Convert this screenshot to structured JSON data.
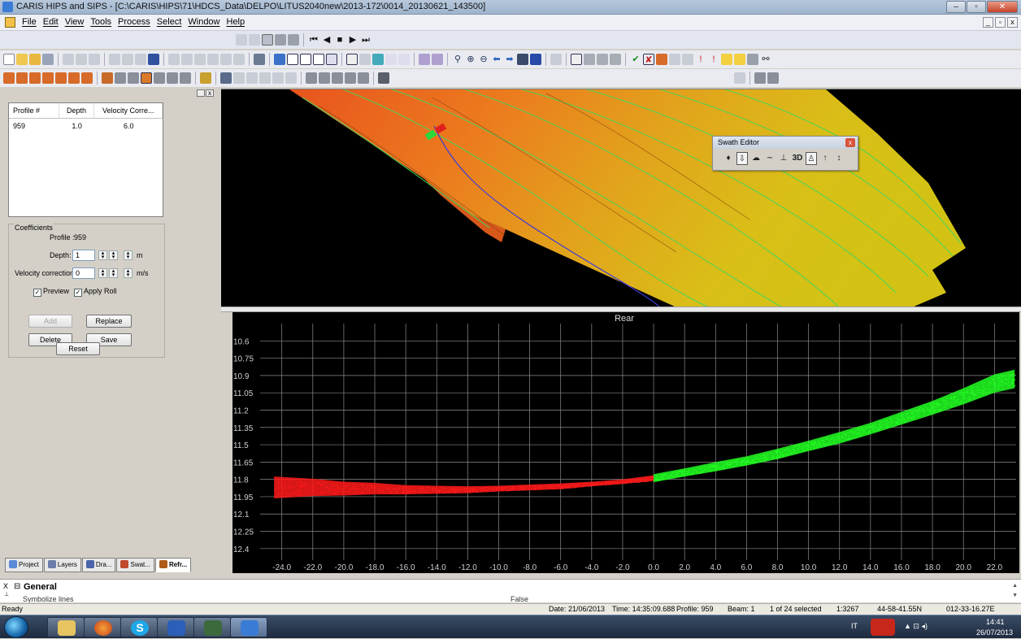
{
  "window": {
    "title": "CARIS HIPS and SIPS - [C:\\CARIS\\HIPS\\71\\HDCS_Data\\DELPO\\LITUS2040new\\2013-172\\0014_20130621_143500]",
    "minimize": "–",
    "maximize": "▫",
    "close": "✕"
  },
  "menu": {
    "items": [
      "File",
      "Edit",
      "View",
      "Tools",
      "Process",
      "Select",
      "Window",
      "Help"
    ],
    "mdi_min": "_",
    "mdi_restore": "▫",
    "mdi_close": "x"
  },
  "left_panel": {
    "table": {
      "headers": [
        "Profile #",
        "Depth",
        "Velocity Corre..."
      ],
      "rows": [
        [
          "959",
          "1.0",
          "6.0"
        ]
      ]
    },
    "coefficients": {
      "title": "Coefficients",
      "profile_label": "Profile :",
      "profile_value": "959",
      "depth_label": "Depth:",
      "depth_value": "1",
      "depth_unit": "m",
      "velocity_label": "Velocity correction:",
      "velocity_value": "0",
      "velocity_unit": "m/s",
      "preview_label": "Preview",
      "apply_roll_label": "Apply Roll"
    },
    "buttons": {
      "add": "Add",
      "replace": "Replace",
      "delete": "Delete",
      "save": "Save",
      "reset": "Reset"
    },
    "tabs": [
      "Project",
      "Layers",
      "Dra...",
      "Swat...",
      "Refr..."
    ],
    "tab_colors": [
      "#5b8bd6",
      "#6a7da8",
      "#4b63a8",
      "#c0482c",
      "#b05a18"
    ]
  },
  "swath_editor": {
    "title": "Swath Editor",
    "tools": [
      "♦",
      "⇩",
      "☁",
      "∼",
      "⊥",
      "3D",
      "♙",
      "↑",
      "↕"
    ],
    "close": "x"
  },
  "chart_data": {
    "type": "scatter",
    "title": "Rear",
    "xlabel": "",
    "ylabel": "",
    "x_ticks": [
      "-24.0",
      "-22.0",
      "-20.0",
      "-18.0",
      "-16.0",
      "-14.0",
      "-12.0",
      "-10.0",
      "-8.0",
      "-6.0",
      "-4.0",
      "-2.0",
      "0.0",
      "2.0",
      "4.0",
      "6.0",
      "8.0",
      "10.0",
      "12.0",
      "14.0",
      "16.0",
      "18.0",
      "20.0",
      "22.0"
    ],
    "y_ticks": [
      "10.6",
      "10.75",
      "10.9",
      "11.05",
      "11.2",
      "11.35",
      "11.5",
      "11.65",
      "11.8",
      "11.95",
      "12.1",
      "12.25",
      "12.4"
    ],
    "xlim": [
      -25.4,
      23.4
    ],
    "ylim": [
      10.45,
      12.5
    ],
    "y_inverted": true,
    "grid": true,
    "series": [
      {
        "color": "#ff1a1a",
        "x": [
          -24.5,
          -22,
          -20,
          -18,
          -16,
          -14,
          -12,
          -10,
          -8,
          -6,
          -4,
          -2,
          0
        ],
        "y": [
          11.87,
          11.87,
          11.88,
          11.88,
          11.89,
          11.89,
          11.89,
          11.88,
          11.87,
          11.86,
          11.84,
          11.82,
          11.79
        ],
        "spread": [
          0.19,
          0.15,
          0.12,
          0.1,
          0.08,
          0.07,
          0.06,
          0.05,
          0.05,
          0.05,
          0.04,
          0.04,
          0.05
        ]
      },
      {
        "color": "#22ff22",
        "x": [
          0,
          2,
          4,
          6,
          8,
          10,
          12,
          14,
          16,
          18,
          20,
          22,
          23.3
        ],
        "y": [
          11.79,
          11.74,
          11.69,
          11.64,
          11.58,
          11.51,
          11.44,
          11.36,
          11.27,
          11.18,
          11.08,
          10.97,
          10.93
        ],
        "spread": [
          0.07,
          0.07,
          0.08,
          0.08,
          0.09,
          0.09,
          0.1,
          0.1,
          0.11,
          0.12,
          0.14,
          0.16,
          0.16
        ]
      }
    ]
  },
  "general_panel": {
    "x": "X",
    "expander": "⊟",
    "title": "General",
    "item": "Symbolize lines",
    "value": "False"
  },
  "status": {
    "ready": "Ready",
    "date": "Date: 21/06/2013",
    "time": "Time:  14:35:09.688",
    "profile": "Profile: 959",
    "beam": "Beam: 1",
    "selected": "1 of 24 selected",
    "scale": "1:3267",
    "lat": "44-58-41.55N",
    "lon": "012-33-16.27E"
  },
  "taskbar": {
    "lang": "IT",
    "time": "14:41",
    "date": "26/07/2013",
    "tray_icons": "▲ ⊡ ◂)"
  }
}
